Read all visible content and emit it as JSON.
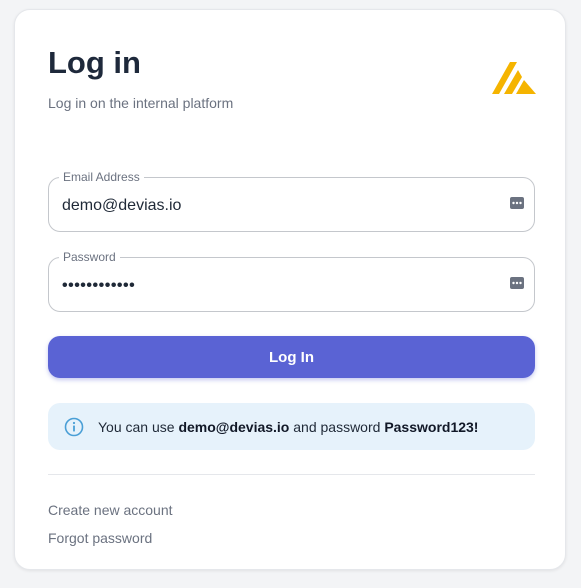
{
  "header": {
    "title": "Log in",
    "subtitle": "Log in on the internal platform",
    "logo_icon": "devias-logo-icon",
    "logo_color": "#f5b400"
  },
  "form": {
    "email": {
      "label": "Email Address",
      "value": "demo@devias.io"
    },
    "password": {
      "label": "Password",
      "value": "••••••••••••"
    },
    "login_button": "Log In",
    "button_color": "#5a63d4"
  },
  "alert": {
    "prefix": "You can use ",
    "email": "demo@devias.io",
    "middle": " and password ",
    "password": "Password123!",
    "icon": "info-icon",
    "background": "#e6f2fb"
  },
  "links": {
    "create_account": "Create new account",
    "forgot_password": "Forgot password"
  }
}
